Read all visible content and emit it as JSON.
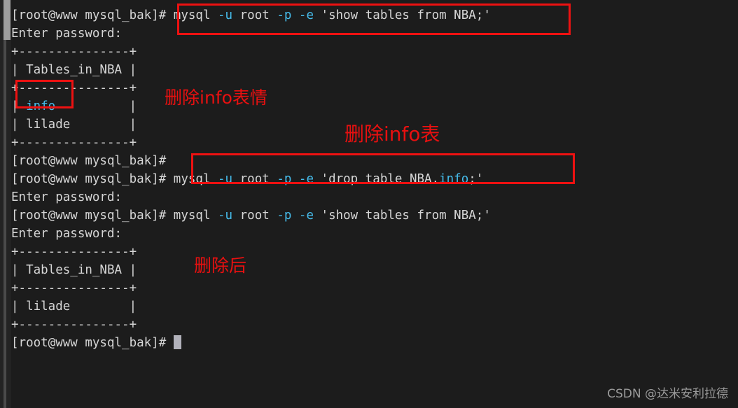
{
  "terminal": {
    "background": "#1c1c1c",
    "foreground": "#d6d6d6",
    "accent_cyan": "#46bdec",
    "annotation_red": "#e81010",
    "prompt": "[root@www mysql_bak]#",
    "lines": [
      {
        "id": "line-1-command-show-tables-1",
        "segments": [
          {
            "text": "[root@www mysql_bak]# ",
            "color": "white"
          },
          {
            "text": "mysql ",
            "color": "white"
          },
          {
            "text": "-u ",
            "color": "cyan"
          },
          {
            "text": "root ",
            "color": "white"
          },
          {
            "text": "-p ",
            "color": "cyan"
          },
          {
            "text": "-e ",
            "color": "cyan"
          },
          {
            "text": "'show tables from NBA;'",
            "color": "white"
          }
        ]
      },
      {
        "id": "line-2-enter-password-1",
        "segments": [
          {
            "text": "Enter password:",
            "color": "white"
          }
        ]
      },
      {
        "id": "line-3-table-top-border-1",
        "segments": [
          {
            "text": "+---------------+",
            "color": "white"
          }
        ]
      },
      {
        "id": "line-4-table-header-1",
        "segments": [
          {
            "text": "| Tables_in_NBA |",
            "color": "white"
          }
        ]
      },
      {
        "id": "line-5-table-mid-border-1",
        "segments": [
          {
            "text": "+---------------+",
            "color": "white"
          }
        ]
      },
      {
        "id": "line-6-table-row-info",
        "segments": [
          {
            "text": "| ",
            "color": "white"
          },
          {
            "text": "info",
            "color": "cyan"
          },
          {
            "text": "          |",
            "color": "white"
          }
        ]
      },
      {
        "id": "line-7-table-row-lilade-1",
        "segments": [
          {
            "text": "| lilade        |",
            "color": "white"
          }
        ]
      },
      {
        "id": "line-8-table-bottom-border-1",
        "segments": [
          {
            "text": "+---------------+",
            "color": "white"
          }
        ]
      },
      {
        "id": "line-9-empty-prompt-1",
        "segments": [
          {
            "text": "[root@www mysql_bak]#",
            "color": "white"
          }
        ]
      },
      {
        "id": "line-10-command-drop-table",
        "segments": [
          {
            "text": "[root@www mysql_bak]# ",
            "color": "white"
          },
          {
            "text": "mysql ",
            "color": "white"
          },
          {
            "text": "-u ",
            "color": "cyan"
          },
          {
            "text": "root ",
            "color": "white"
          },
          {
            "text": "-p ",
            "color": "cyan"
          },
          {
            "text": "-e ",
            "color": "cyan"
          },
          {
            "text": "'drop table NBA.",
            "color": "white"
          },
          {
            "text": "info",
            "color": "cyan"
          },
          {
            "text": ";'",
            "color": "white"
          }
        ]
      },
      {
        "id": "line-11-enter-password-2",
        "segments": [
          {
            "text": "Enter password:",
            "color": "white"
          }
        ]
      },
      {
        "id": "line-12-command-show-tables-2",
        "segments": [
          {
            "text": "[root@www mysql_bak]# ",
            "color": "white"
          },
          {
            "text": "mysql ",
            "color": "white"
          },
          {
            "text": "-u ",
            "color": "cyan"
          },
          {
            "text": "root ",
            "color": "white"
          },
          {
            "text": "-p ",
            "color": "cyan"
          },
          {
            "text": "-e ",
            "color": "cyan"
          },
          {
            "text": "'show tables from NBA;'",
            "color": "white"
          }
        ]
      },
      {
        "id": "line-13-enter-password-3",
        "segments": [
          {
            "text": "Enter password:",
            "color": "white"
          }
        ]
      },
      {
        "id": "line-14-table-top-border-2",
        "segments": [
          {
            "text": "+---------------+",
            "color": "white"
          }
        ]
      },
      {
        "id": "line-15-table-header-2",
        "segments": [
          {
            "text": "| Tables_in_NBA |",
            "color": "white"
          }
        ]
      },
      {
        "id": "line-16-table-mid-border-2",
        "segments": [
          {
            "text": "+---------------+",
            "color": "white"
          }
        ]
      },
      {
        "id": "line-17-table-row-lilade-2",
        "segments": [
          {
            "text": "| lilade        |",
            "color": "white"
          }
        ]
      },
      {
        "id": "line-18-table-bottom-border-2",
        "segments": [
          {
            "text": "+---------------+",
            "color": "white"
          }
        ]
      },
      {
        "id": "line-19-final-prompt",
        "segments": [
          {
            "text": "[root@www mysql_bak]# ",
            "color": "white"
          }
        ],
        "cursor": true
      }
    ]
  },
  "annotations": {
    "delete_info_table_emoji": "删除info表情",
    "delete_info_table": "删除info表",
    "after_delete": "删除后"
  },
  "watermark": {
    "text": "CSDN @达米安利拉德"
  }
}
